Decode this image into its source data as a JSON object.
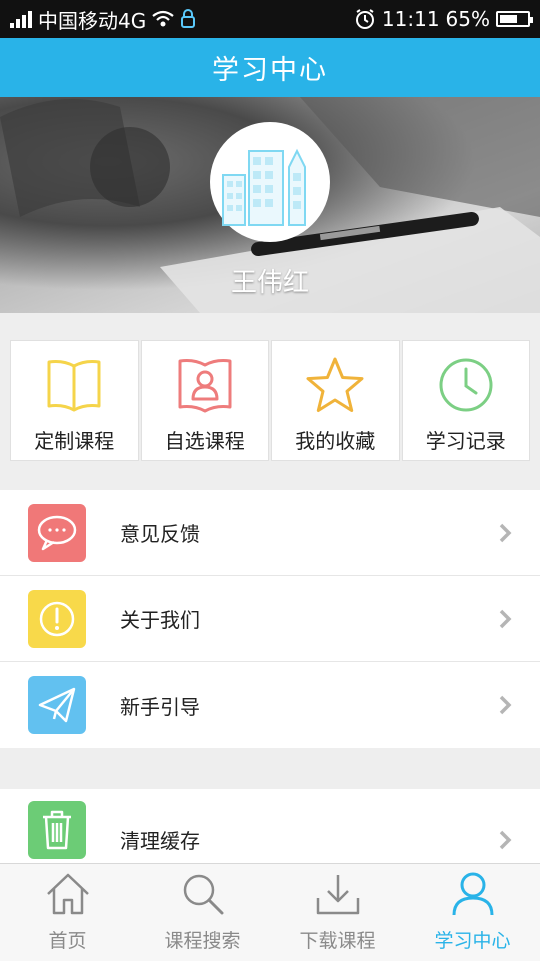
{
  "status_bar": {
    "carrier": "中国移动4G",
    "time": "11:11",
    "battery_percent": "65%",
    "battery_level": 0.65
  },
  "header": {
    "title": "学习中心"
  },
  "profile": {
    "username": "王伟红"
  },
  "quick_actions": [
    {
      "label": "定制课程",
      "icon": "open-book-icon",
      "color": "#f5d44a"
    },
    {
      "label": "自选课程",
      "icon": "person-book-icon",
      "color": "#ee7c7c"
    },
    {
      "label": "我的收藏",
      "icon": "star-icon",
      "color": "#f0b33a"
    },
    {
      "label": "学习记录",
      "icon": "clock-icon",
      "color": "#7ccf84"
    }
  ],
  "menu_group_1": [
    {
      "label": "意见反馈",
      "icon": "chat-bubble-icon",
      "color": "#f07878"
    },
    {
      "label": "关于我们",
      "icon": "exclamation-icon",
      "color": "#f8d94a"
    },
    {
      "label": "新手引导",
      "icon": "paper-plane-icon",
      "color": "#62c1f0"
    }
  ],
  "menu_group_2": [
    {
      "label": "清理缓存",
      "icon": "trash-icon",
      "color": "#6ccc76"
    }
  ],
  "tab_bar": {
    "tabs": [
      {
        "label": "首页",
        "icon": "home-icon"
      },
      {
        "label": "课程搜索",
        "icon": "search-icon"
      },
      {
        "label": "下载课程",
        "icon": "download-icon"
      },
      {
        "label": "学习中心",
        "icon": "user-icon",
        "active": true
      }
    ],
    "active_color": "#29b3e8"
  }
}
